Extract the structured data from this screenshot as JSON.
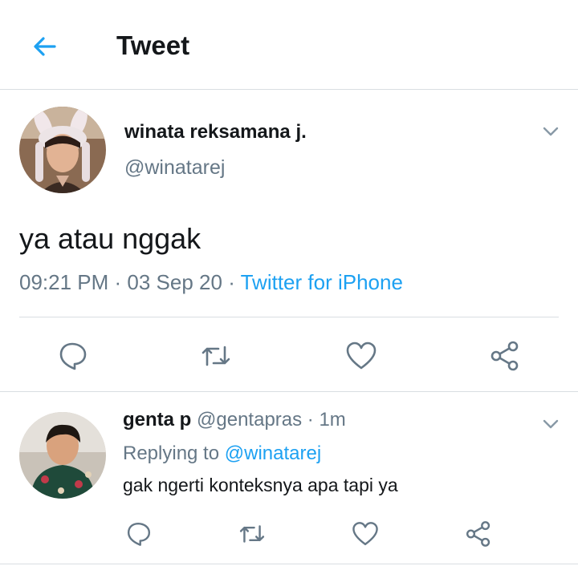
{
  "header": {
    "title": "Tweet",
    "back_icon": "arrow-left-icon"
  },
  "tweet": {
    "author_name": "winata reksamana j.",
    "author_handle": "@winatarej",
    "text": "ya atau nggak",
    "time": "09:21 PM",
    "date": "03 Sep 20",
    "source": "Twitter for iPhone",
    "separator": " · ",
    "actions": [
      "reply-icon",
      "retweet-icon",
      "like-icon",
      "share-icon"
    ]
  },
  "reply": {
    "author_name": "genta p",
    "author_handle": "@gentapras",
    "time": "1m",
    "dot": " · ",
    "replying_prefix": "Replying to ",
    "replying_to": "@winatarej",
    "text": "gak ngerti konteksnya apa tapi ya",
    "actions": [
      "reply-icon",
      "retweet-icon",
      "like-icon",
      "share-icon"
    ]
  },
  "colors": {
    "accent": "#1da1f2",
    "text": "#14171a",
    "secondary": "#657786",
    "divider": "#d9dee2"
  }
}
